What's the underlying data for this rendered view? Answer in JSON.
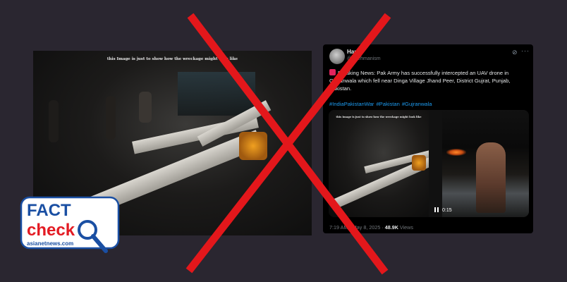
{
  "left_photo": {
    "caption": "this Image is just to show how the wreckage might look like"
  },
  "tweet": {
    "name": "Ham",
    "handle": "@...rehmanism",
    "body": "Breaking News: Pak Army has successfully intercepted an UAV drone in Gujranwala which fell near Dinga Village Jhand Peer, District Gujrat, Punjab, Pakistan.",
    "hashtags": [
      "#IndiaPakistanWar",
      "#Pakistan",
      "#Gujranwala"
    ],
    "media_caption": "this Image is just to show how the wreckage might look like",
    "video_time": "0:15",
    "timestamp": "7:19 AM · May 8, 2025 ·",
    "views_count": "48.9K",
    "views_label": "Views"
  },
  "logo": {
    "line1": "FACT",
    "line2": "check",
    "brand": "asianetnews.com"
  },
  "colors": {
    "background": "#2a2630",
    "cross": "#e3171b",
    "link": "#1d9bf0",
    "logo_blue": "#1a4fa3",
    "logo_red": "#e31b23"
  }
}
